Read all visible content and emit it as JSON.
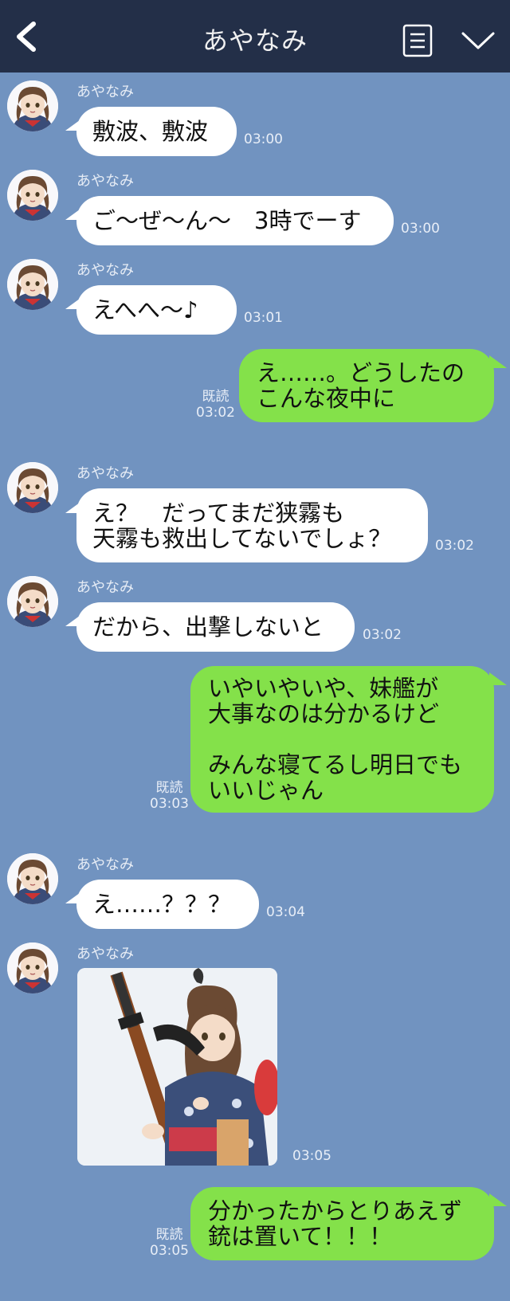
{
  "header": {
    "title": "あやなみ",
    "back_icon": "chevron-left-icon",
    "menu_icon": "list-menu-icon",
    "collapse_icon": "chevron-down-icon"
  },
  "colors": {
    "header_bg": "#232f48",
    "chat_bg": "#7193c0",
    "incoming_bubble": "#ffffff",
    "outgoing_bubble": "#84e14a"
  },
  "messages": [
    {
      "sender": "あやなみ",
      "text": "敷波、敷波",
      "time": "03:00"
    },
    {
      "sender": "あやなみ",
      "text": "ご〜ぜ〜ん〜　3時でーす",
      "time": "03:00"
    },
    {
      "sender": "あやなみ",
      "text": "えへへ〜♪",
      "time": "03:01"
    },
    {
      "read": "既読",
      "text": "え……。どうしたの\nこんな夜中に",
      "time": "03:02"
    },
    {
      "sender": "あやなみ",
      "text": "え？　だってまだ狭霧も\n天霧も救出してないでしょ？",
      "time": "03:02"
    },
    {
      "sender": "あやなみ",
      "text": "だから、出撃しないと",
      "time": "03:02"
    },
    {
      "read": "既読",
      "text": "いやいやいや、妹艦が\n大事なのは分かるけど\n\nみんな寝てるし明日でも\nいいじゃん",
      "time": "03:03"
    },
    {
      "sender": "あやなみ",
      "text": "え……？？？",
      "time": "03:04"
    },
    {
      "sender": "あやなみ",
      "image": "girl-in-yukata-holding-rifle",
      "time": "03:05"
    },
    {
      "read": "既読",
      "text": "分かったからとりあえず\n銃は置いて！！！",
      "time": "03:05"
    }
  ]
}
